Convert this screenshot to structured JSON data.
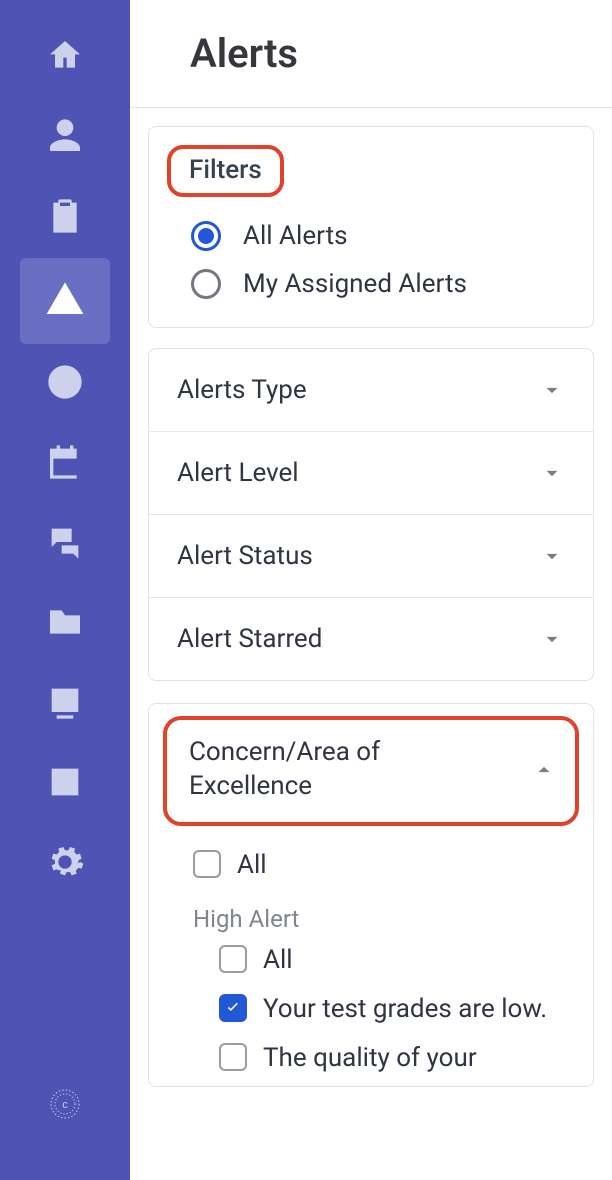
{
  "page": {
    "title": "Alerts"
  },
  "filters": {
    "label": "Filters",
    "radios": {
      "all": "All Alerts",
      "mine": "My Assigned Alerts",
      "selected": "all"
    }
  },
  "accordions": [
    {
      "label": "Alerts Type",
      "open": false
    },
    {
      "label": "Alert Level",
      "open": false
    },
    {
      "label": "Alert Status",
      "open": false
    },
    {
      "label": "Alert Starred",
      "open": false
    }
  ],
  "concern": {
    "label": "Concern/Area of Excellence",
    "open": true,
    "top_all": "All",
    "group_heading": "High Alert",
    "items": [
      {
        "label": "All",
        "checked": false
      },
      {
        "label": "Your test grades are low.",
        "checked": true
      },
      {
        "label": "The quality of your",
        "checked": false
      }
    ]
  },
  "sidebar": {
    "items": [
      "home",
      "people",
      "clipboard",
      "alerts",
      "bolt",
      "calendar",
      "chat",
      "folder",
      "contact",
      "analytics",
      "settings"
    ],
    "active": "alerts"
  }
}
